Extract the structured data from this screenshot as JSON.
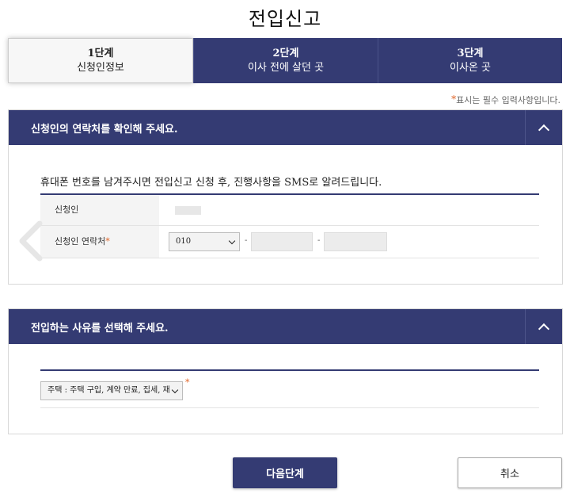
{
  "page": {
    "title": "전입신고"
  },
  "steps": [
    {
      "num": "1단계",
      "label": "신청인정보",
      "active": true
    },
    {
      "num": "2단계",
      "label": "이사 전에 살던 곳",
      "active": false
    },
    {
      "num": "3단계",
      "label": "이사온 곳",
      "active": false
    }
  ],
  "required_note": {
    "star": "*",
    "text": "표시는 필수 입력사항입니다."
  },
  "contact_section": {
    "heading": "신청인의 연락처를 확인해 주세요.",
    "info": "휴대폰 번호를 남겨주시면 전입신고 신청 후, 진행사항을 SMS로 알려드립니다.",
    "applicant_label": "신청인",
    "contact_label": "신청인 연락처",
    "contact_required": "*",
    "phone_prefix": "010",
    "separator": "-"
  },
  "reason_section": {
    "heading": "전입하는 사유를 선택해 주세요.",
    "selected_reason": "주택 : 주택 구입, 계약 만료, 집세, 재",
    "required": "*"
  },
  "buttons": {
    "next": "다음단계",
    "cancel": "취소"
  },
  "colors": {
    "primary": "#343b73",
    "required": "#e0662a"
  }
}
